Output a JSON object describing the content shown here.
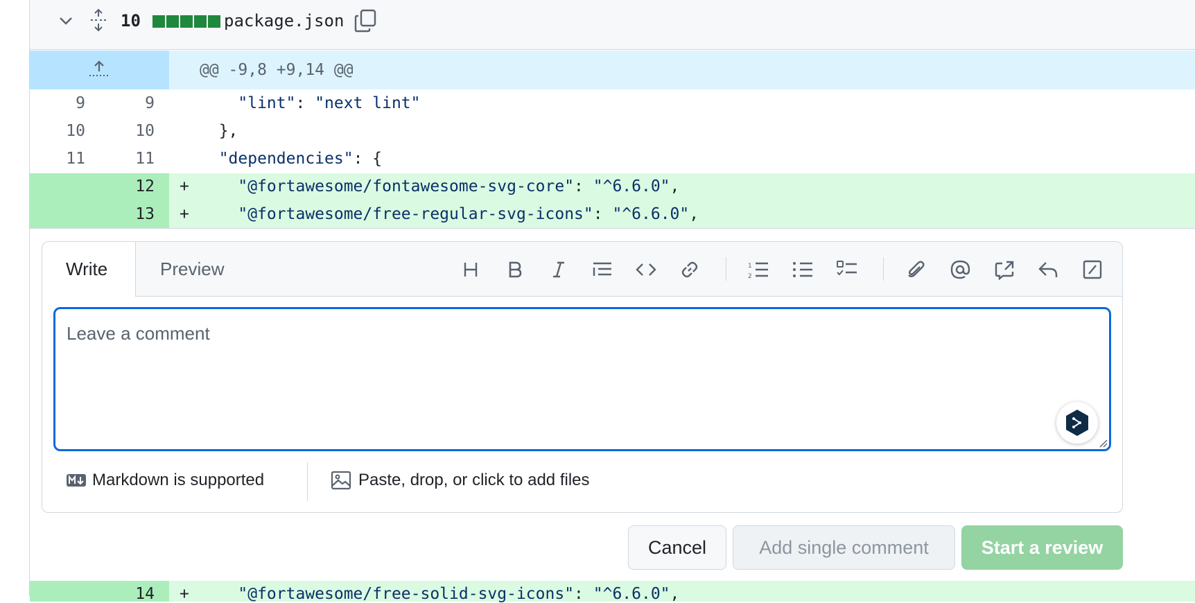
{
  "file": {
    "changes_count": "10",
    "filename": "package.json"
  },
  "hunk": {
    "header": "@@ -9,8 +9,14 @@"
  },
  "lines": [
    {
      "old": "9",
      "new": "9",
      "sign": "",
      "pre": "    ",
      "key": "\"lint\"",
      "mid": ": ",
      "val": "\"next lint\"",
      "post": ""
    },
    {
      "old": "10",
      "new": "10",
      "sign": "",
      "pre": "  },",
      "key": "",
      "mid": "",
      "val": "",
      "post": ""
    },
    {
      "old": "11",
      "new": "11",
      "sign": "",
      "pre": "  ",
      "key": "\"dependencies\"",
      "mid": ": {",
      "val": "",
      "post": ""
    },
    {
      "old": "",
      "new": "12",
      "sign": "+",
      "pre": "    ",
      "key": "\"@fortawesome/fontawesome-svg-core\"",
      "mid": ": ",
      "val": "\"^6.6.0\"",
      "post": ","
    },
    {
      "old": "",
      "new": "13",
      "sign": "+",
      "pre": "    ",
      "key": "\"@fortawesome/free-regular-svg-icons\"",
      "mid": ": ",
      "val": "\"^6.6.0\"",
      "post": ","
    },
    {
      "old": "",
      "new": "14",
      "sign": "+",
      "pre": "    ",
      "key": "\"@fortawesome/free-solid-svg-icons\"",
      "mid": ": ",
      "val": "\"^6.6.0\"",
      "post": ","
    }
  ],
  "comment": {
    "tab_write": "Write",
    "tab_preview": "Preview",
    "placeholder": "Leave a comment",
    "markdown_note": "Markdown is supported",
    "files_note": "Paste, drop, or click to add files",
    "toolbar": [
      "heading-icon",
      "bold-icon",
      "italic-icon",
      "quote-icon",
      "code-icon",
      "link-icon",
      "numbered-list-icon",
      "unordered-list-icon",
      "task-list-icon",
      "attach-icon",
      "mention-icon",
      "cross-reference-icon",
      "saved-reply-icon",
      "slash-command-icon"
    ]
  },
  "actions": {
    "cancel": "Cancel",
    "add_single": "Add single comment",
    "start_review": "Start a review"
  },
  "colors": {
    "accent": "#0969da",
    "add_bg": "#dafbe1",
    "add_gutter": "#aceebb",
    "hunk_bg": "#ddf4ff",
    "diffstat": "#1f883d",
    "review_btn": "#94d3a2"
  }
}
